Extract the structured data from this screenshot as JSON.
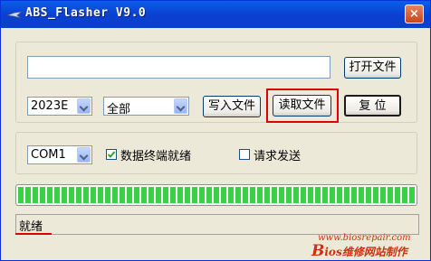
{
  "window": {
    "title": "ABS_Flasher V9.0",
    "close_label": "×"
  },
  "file_path": {
    "value": "",
    "placeholder": ""
  },
  "buttons": {
    "open_file": "打开文件",
    "write_file": "写入文件",
    "read_file": "读取文件",
    "reset": "复 位"
  },
  "selects": {
    "chip_model": "2023E",
    "region": "全部",
    "port": "COM1"
  },
  "options": {
    "data_terminal_ready": {
      "label": "数据终端就绪",
      "checked": true
    },
    "request_to_send": {
      "label": "请求发送",
      "checked": false
    }
  },
  "progress": {
    "fraction": 1.0,
    "color": "#38d246"
  },
  "status_text": "就绪",
  "watermark": {
    "url": "www.biosrepair.com",
    "brand_letter": "B",
    "brand_rest": "ios维修网站制作",
    "color": "#d03010"
  },
  "colors": {
    "highlight": "#e00000",
    "title_bar": "#0a5ee8"
  }
}
